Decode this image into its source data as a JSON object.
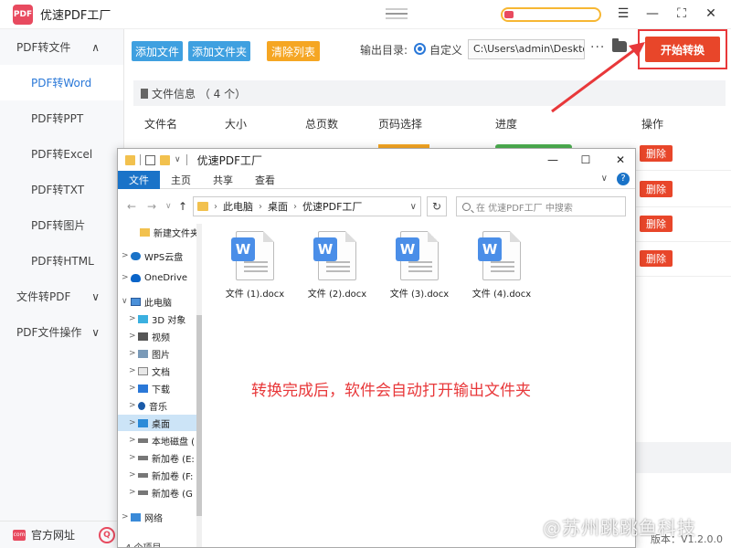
{
  "app": {
    "title": "优速PDF工厂",
    "logo_text": "PDF"
  },
  "window_controls": {
    "menu": "☰",
    "minimize": "—",
    "maximize": "⛶",
    "close": "✕"
  },
  "sidebar": {
    "items": [
      {
        "label": "PDF转文件",
        "type": "group",
        "chevron": "∧"
      },
      {
        "label": "PDF转Word",
        "type": "item",
        "active": true
      },
      {
        "label": "PDF转PPT",
        "type": "item"
      },
      {
        "label": "PDF转Excel",
        "type": "item"
      },
      {
        "label": "PDF转TXT",
        "type": "item"
      },
      {
        "label": "PDF转图片",
        "type": "item"
      },
      {
        "label": "PDF转HTML",
        "type": "item"
      },
      {
        "label": "文件转PDF",
        "type": "group",
        "chevron": "∨"
      },
      {
        "label": "PDF文件操作",
        "type": "group",
        "chevron": "∨"
      }
    ],
    "footer": {
      "website_label": "官方网址",
      "web_icon_text": "com",
      "qq_icon_text": "Q"
    }
  },
  "toolbar": {
    "add_file": "添加文件",
    "add_folder": "添加文件夹",
    "clear_list": "清除列表",
    "output_label": "输出目录:",
    "radio_label": "自定义",
    "output_path": "C:\\Users\\admin\\Deskto",
    "more": "···",
    "start_button": "开始转换"
  },
  "file_info": {
    "label": "文件信息 （ 4 个）"
  },
  "columns": [
    "文件名",
    "大小",
    "总页数",
    "页码选择",
    "进度",
    "操作"
  ],
  "delete_label": "删除",
  "version": "版本：V1.2.0.0",
  "explorer": {
    "title": "优速PDF工厂",
    "tabs": [
      "文件",
      "主页",
      "共享",
      "查看"
    ],
    "controls": {
      "minimize": "—",
      "maximize": "☐",
      "close": "✕",
      "help": "?",
      "chevron": "∨"
    },
    "nav": {
      "back": "←",
      "forward": "→",
      "recent": "∨",
      "up": "↑",
      "dropdown": "∨",
      "refresh": "↻"
    },
    "address": [
      "此电脑",
      "桌面",
      "优速PDF工厂"
    ],
    "address_sep": "›",
    "search_placeholder": "在 优速PDF工厂 中搜索",
    "tree": [
      {
        "label": "新建文件夹",
        "icon": "folder-icon",
        "caret": ""
      },
      {
        "label": "WPS云盘",
        "icon": "cloud-icon",
        "caret": ">"
      },
      {
        "label": "OneDrive",
        "icon": "onedrive-icon",
        "caret": ">"
      },
      {
        "label": "此电脑",
        "icon": "computer-icon",
        "caret": "∨"
      },
      {
        "label": "3D 对象",
        "icon": "cube-icon",
        "caret": ">"
      },
      {
        "label": "视频",
        "icon": "video-icon",
        "caret": ">"
      },
      {
        "label": "图片",
        "icon": "picture-icon",
        "caret": ">"
      },
      {
        "label": "文档",
        "icon": "document-icon",
        "caret": ">"
      },
      {
        "label": "下载",
        "icon": "download-icon",
        "caret": ">"
      },
      {
        "label": "音乐",
        "icon": "music-icon",
        "caret": ">"
      },
      {
        "label": "桌面",
        "icon": "desktop-icon",
        "caret": ">",
        "selected": true
      },
      {
        "label": "本地磁盘 (",
        "icon": "drive-icon",
        "caret": ">"
      },
      {
        "label": "新加卷 (E:",
        "icon": "drive-icon",
        "caret": ">"
      },
      {
        "label": "新加卷 (F:",
        "icon": "drive-icon",
        "caret": ">"
      },
      {
        "label": "新加卷 (G",
        "icon": "drive-icon",
        "caret": ">"
      },
      {
        "label": "网络",
        "icon": "network-icon",
        "caret": ">"
      }
    ],
    "files": [
      "文件 (1).docx",
      "文件 (2).docx",
      "文件 (3).docx",
      "文件 (4).docx"
    ],
    "file_badge": "W",
    "note": "转换完成后，软件会自动打开输出文件夹",
    "status": "4 个项目"
  },
  "watermark": "@苏州跳跳鱼科技",
  "colors": {
    "accent_blue": "#3fa0e0",
    "start_red": "#e8462a",
    "clear_orange": "#f5a623",
    "note_red": "#e8383a",
    "explorer_blue": "#1a73c8"
  }
}
